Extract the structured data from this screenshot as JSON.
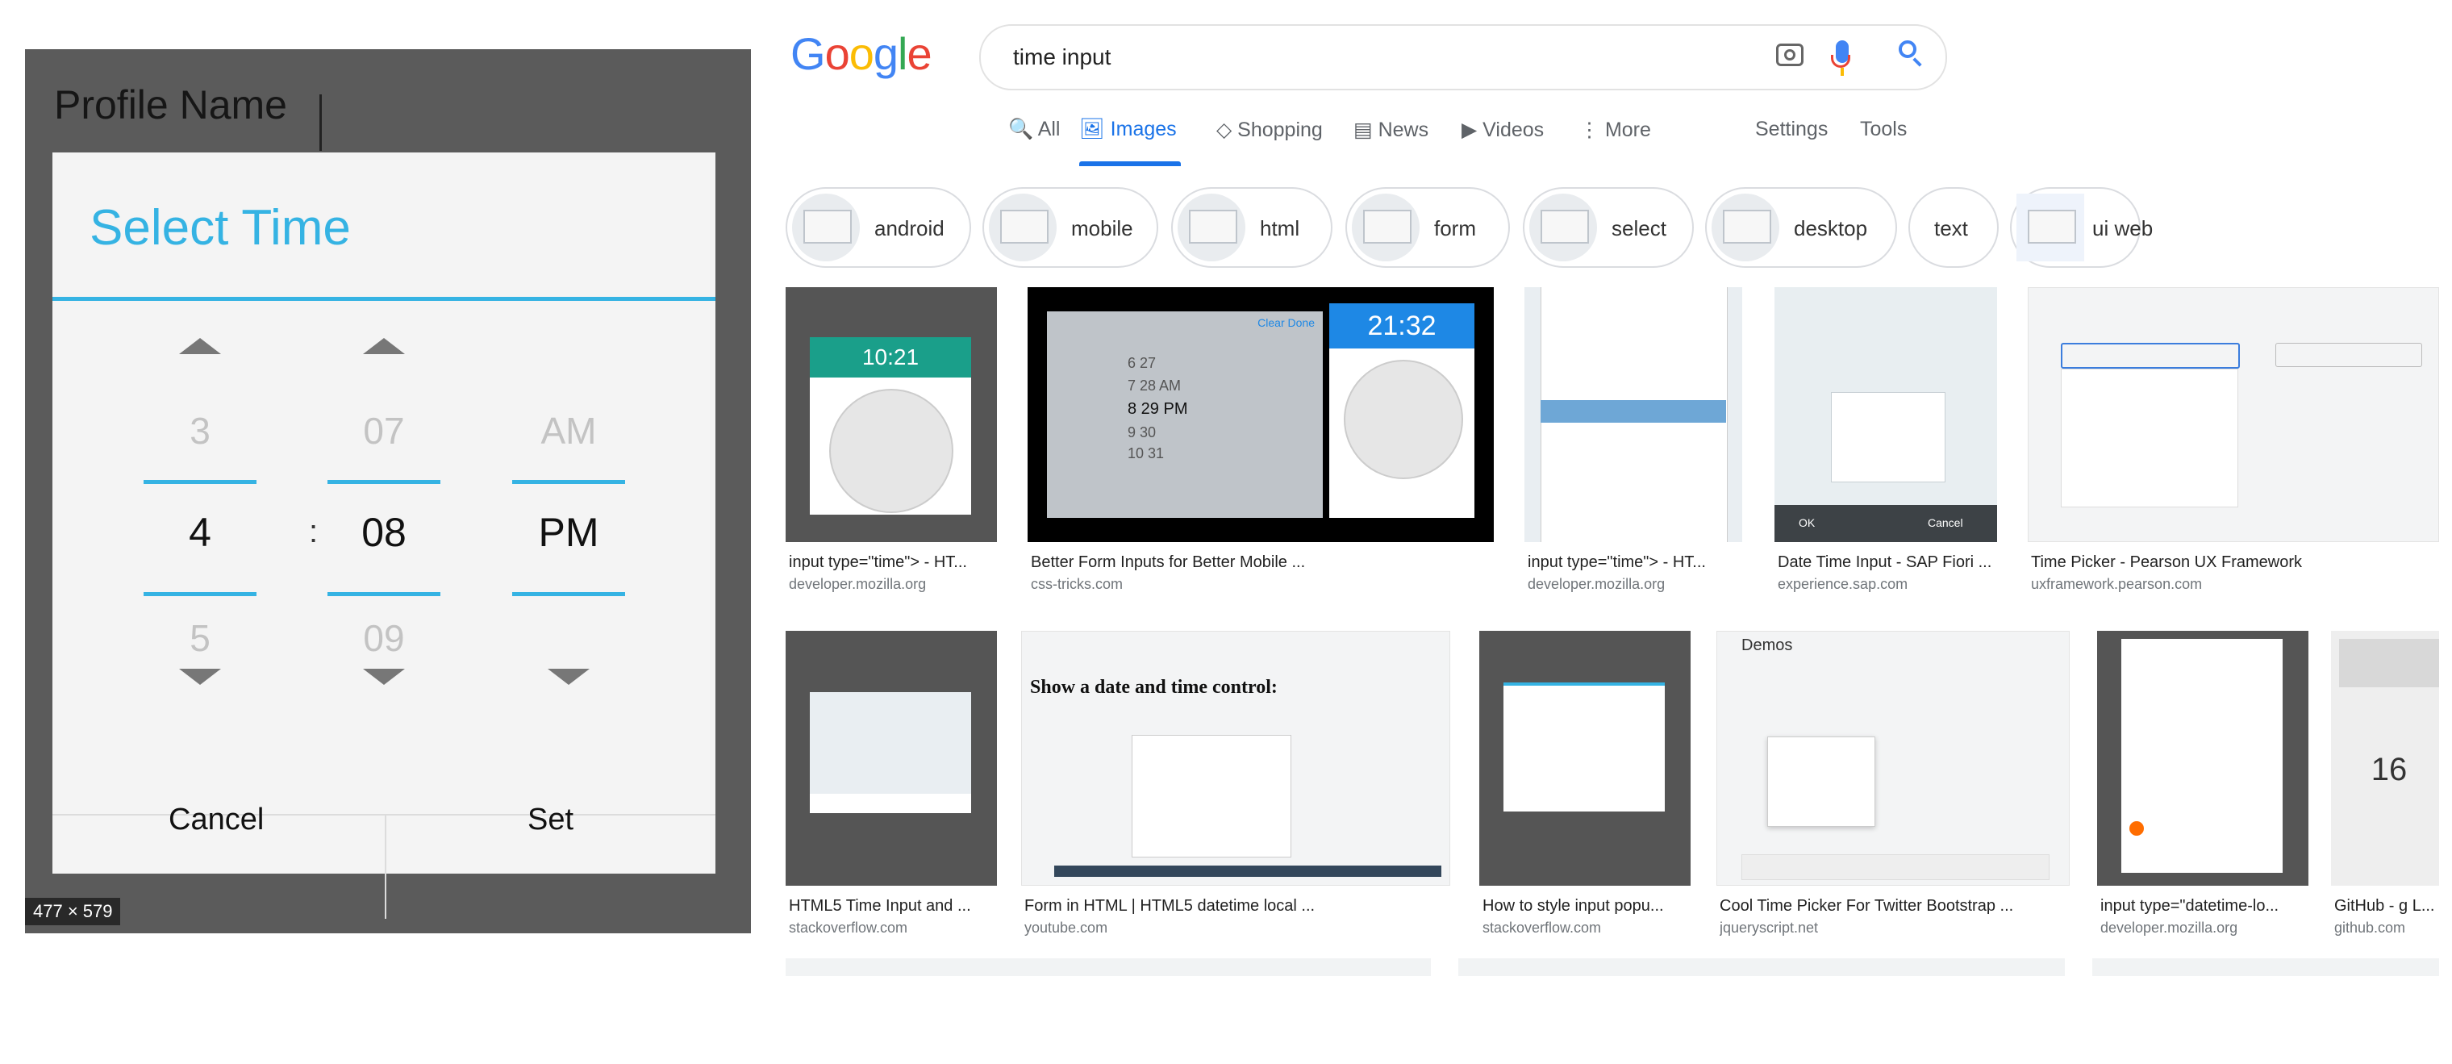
{
  "preview": {
    "profile_label": "Profile Name",
    "dialog_title": "Select Time",
    "hour": {
      "prev": "3",
      "current": "4",
      "next": "5"
    },
    "minute": {
      "prev": "07",
      "current": "08",
      "next": "09"
    },
    "period": {
      "prev": "AM",
      "current": "PM"
    },
    "separator": ":",
    "cancel_label": "Cancel",
    "set_label": "Set",
    "size_tag": "477 × 579"
  },
  "google": {
    "logo_letters": [
      "G",
      "o",
      "o",
      "g",
      "l",
      "e"
    ],
    "logo_colors": [
      "#4285f4",
      "#ea4335",
      "#fbbc05",
      "#4285f4",
      "#34a853",
      "#ea4335"
    ],
    "search_value": "time input",
    "tabs": [
      {
        "label": "🔍 All"
      },
      {
        "label": "🖼 Images"
      },
      {
        "label": "◇ Shopping"
      },
      {
        "label": "▤ News"
      },
      {
        "label": "▶ Videos"
      },
      {
        "label": "⋮ More"
      },
      {
        "label": "Settings"
      },
      {
        "label": "Tools"
      }
    ],
    "chips": [
      "android",
      "mobile",
      "html",
      "form",
      "select",
      "desktop",
      "text",
      "ui web"
    ]
  },
  "results": {
    "row1": [
      {
        "title": "input type=\"time\"> - HT...",
        "source": "developer.mozilla.org",
        "clock_time": "10:21"
      },
      {
        "title": "Better Form Inputs for Better Mobile ...",
        "source": "css-tricks.com",
        "clock_time": "21:32",
        "picker_rows": [
          "6   27",
          "7   28   AM",
          "8   29   PM",
          "9   30",
          "10  31"
        ],
        "picker_done": "Clear  Done"
      },
      {
        "title": "input type=\"time\"> - HT...",
        "source": "developer.mozilla.org"
      },
      {
        "title": "Date Time Input - SAP Fiori ...",
        "source": "experience.sap.com",
        "ok": "OK",
        "cancel": "Cancel"
      },
      {
        "title": "Time Picker - Pearson UX Framework",
        "source": "uxframework.pearson.com"
      }
    ],
    "row2": [
      {
        "title": "HTML5 Time Input and ...",
        "source": "stackoverflow.com"
      },
      {
        "title": "Form in HTML | HTML5 datetime local ...",
        "source": "youtube.com",
        "heading": "Show a date and time control:"
      },
      {
        "title": "How to style input popu...",
        "source": "stackoverflow.com"
      },
      {
        "title": "Cool Time Picker For Twitter Bootstrap ...",
        "source": "jqueryscript.net",
        "heading": "Demos"
      },
      {
        "title": "input type=\"datetime-lo...",
        "source": "developer.mozilla.org"
      },
      {
        "title": "GitHub - g L...",
        "source": "github.com",
        "number": "16"
      }
    ]
  }
}
